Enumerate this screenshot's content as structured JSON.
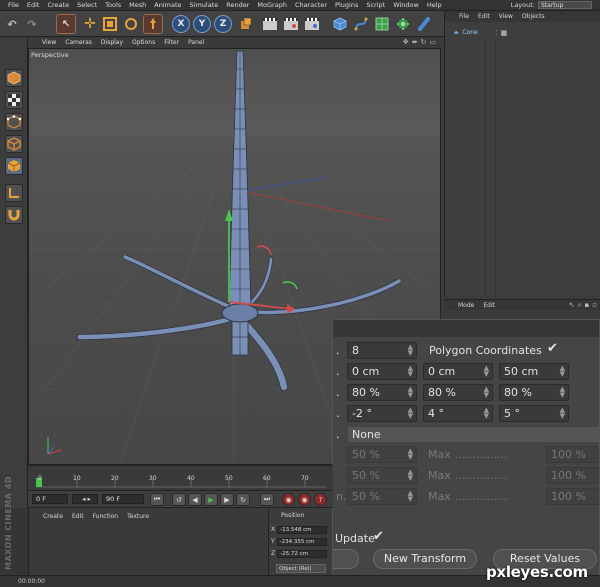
{
  "menubar": {
    "items": [
      "File",
      "Edit",
      "Create",
      "Select",
      "Tools",
      "Mesh",
      "Animate",
      "Simulate",
      "Render",
      "MoGraph",
      "Character",
      "Plugins",
      "Script",
      "Window",
      "Help"
    ],
    "layout_label": "Layout:",
    "layout_value": "Startup"
  },
  "toolbar": {
    "axis_x": "X",
    "axis_y": "Y",
    "axis_z": "Z"
  },
  "viewport": {
    "menu": [
      "View",
      "Cameras",
      "Display",
      "Options",
      "Filter",
      "Panel"
    ],
    "name": "Perspective"
  },
  "objects_panel": {
    "menu": [
      "File",
      "Edit",
      "View",
      "Objects"
    ],
    "item_name": "Cone"
  },
  "attributes_panel": {
    "menu": [
      "Mode",
      "Edit"
    ]
  },
  "dialog": {
    "count_value": "8",
    "polygon_coords_label": "Polygon Coordinates",
    "polygon_coords_check": "✔",
    "move_x": "0 cm",
    "move_y": "0 cm",
    "move_z": "50 cm",
    "scale_x": "80 %",
    "scale_y": "80 %",
    "scale_z": "80 %",
    "rot_x": "-2 °",
    "rot_y": "4 °",
    "rot_z": "5 °",
    "mode_value": "None",
    "var_rows": [
      {
        "min": "50 %",
        "max_label": "Max",
        "max": "100 %"
      },
      {
        "min": "50 %",
        "max_label": "Max",
        "max": "100 %"
      },
      {
        "min": "50 %",
        "max_label": "Max",
        "max": "100 %"
      }
    ],
    "dots": "...............",
    "update_label": "Update",
    "update_check": "✔",
    "new_transform": "New Transform",
    "reset_values": "Reset Values"
  },
  "timeline": {
    "ticks": [
      "0",
      "10",
      "20",
      "30",
      "40",
      "50",
      "60",
      "70"
    ],
    "start_frame": "0 F",
    "end_frame": "90 F"
  },
  "materials_panel": {
    "menu": [
      "Create",
      "Edit",
      "Function",
      "Texture"
    ]
  },
  "coordinates_panel": {
    "title": "Position",
    "rows": [
      {
        "axis": "X",
        "value": "-13.548 cm"
      },
      {
        "axis": "Y",
        "value": "-234.355 cm"
      },
      {
        "axis": "Z",
        "value": "-25.72 cm"
      }
    ],
    "mode_select": "Object (Rel)"
  },
  "branding": {
    "maxon": "MAXON CINEMA 4D",
    "watermark": "pxleyes.com"
  },
  "status": {
    "time": "00:00:00"
  },
  "colors": {
    "mesh": "#7a8fb5",
    "axis_x": "#d24a4a",
    "axis_y": "#4ac44a",
    "axis_z": "#4a6ad2",
    "accent_orange": "#e8a23a"
  }
}
